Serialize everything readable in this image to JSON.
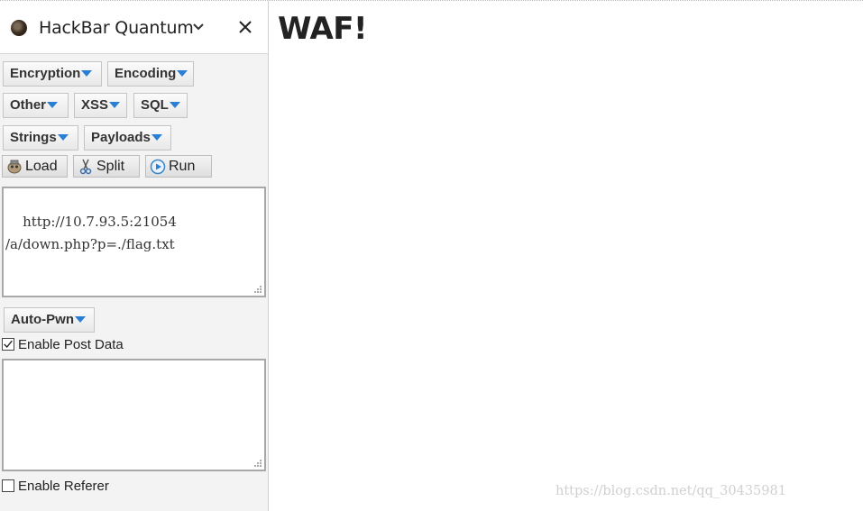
{
  "sidebar": {
    "title": "HackBar Quantum",
    "menus": {
      "encryption": "Encryption",
      "encoding": "Encoding",
      "other": "Other",
      "xss": "XSS",
      "sql": "SQL",
      "strings": "Strings",
      "payloads": "Payloads",
      "auto_pwn": "Auto-Pwn"
    },
    "actions": {
      "load": "Load",
      "split": "Split",
      "run": "Run"
    },
    "url_text": "http://10.7.93.5:21054\n/a/down.php?p=./flag.txt",
    "post_data_label": "Enable Post Data",
    "post_data_checked": true,
    "post_data_text": "",
    "referer_label": "Enable Referer",
    "referer_checked": false
  },
  "page": {
    "heading": "WAF!"
  },
  "watermark": "https://blog.csdn.net/qq_30435981",
  "colors": {
    "dropdown_arrow": "#2a7fd4",
    "sidebar_bg": "#f3f3f3"
  }
}
